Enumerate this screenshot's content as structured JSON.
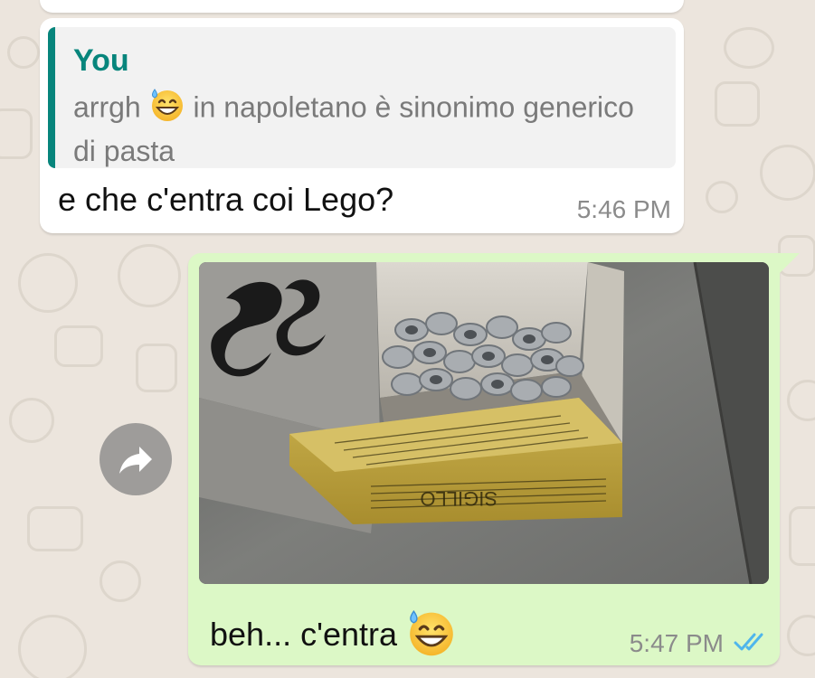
{
  "chat": {
    "incoming": {
      "quote": {
        "author": "You",
        "text_before_emoji": "arrgh ",
        "text_after_emoji": " in napoletano è sinonimo generico di pasta",
        "emoji": "grinning-face-with-sweat"
      },
      "text": "e che c'entra coi Lego?",
      "time": "5:46 PM"
    },
    "outgoing": {
      "image": "photo-box-of-grey-pasta",
      "text": "beh... c'entra",
      "emoji": "grinning-face-with-sweat",
      "time": "5:47 PM",
      "status": "read",
      "status_icon": "double-check-icon"
    },
    "forward_icon": "forward-arrow-icon"
  },
  "colors": {
    "wallpaper": "#ece5dd",
    "incoming_bubble": "#ffffff",
    "outgoing_bubble": "#dcf8c6",
    "quote_accent": "#07857c",
    "read_tick": "#4fb6ec"
  }
}
